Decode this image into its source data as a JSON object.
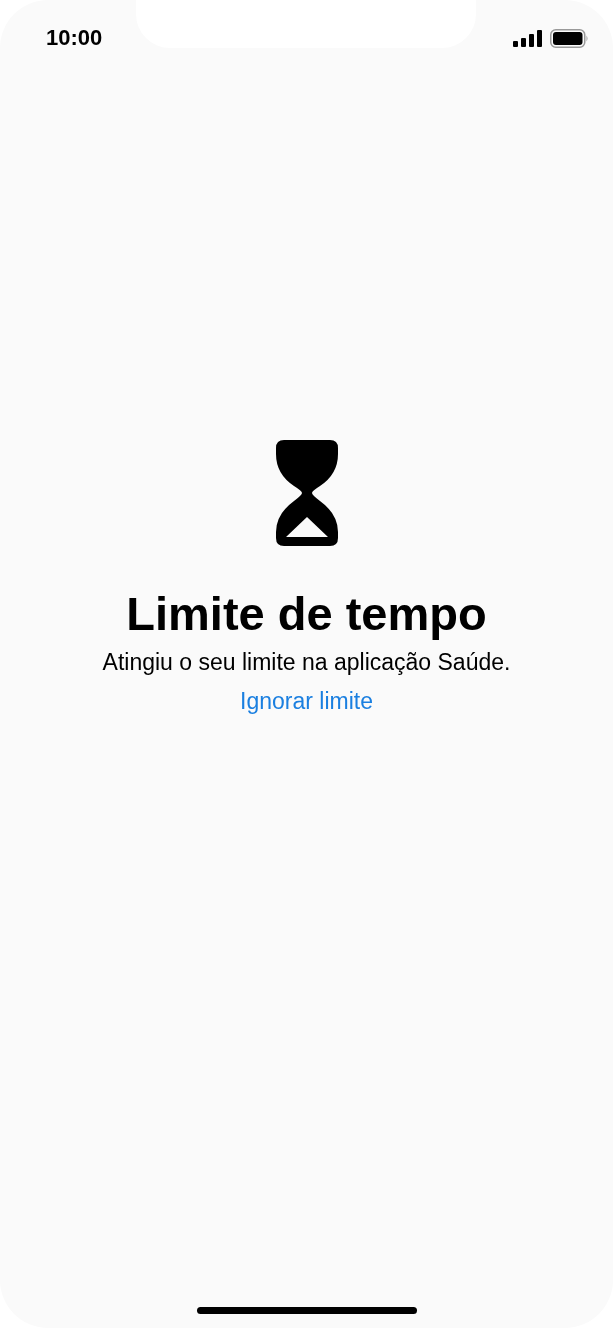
{
  "status_bar": {
    "time": "10:00"
  },
  "screen": {
    "title": "Limite de tempo",
    "message": "Atingiu o seu limite na aplicação Saúde.",
    "link": "Ignorar limite"
  }
}
